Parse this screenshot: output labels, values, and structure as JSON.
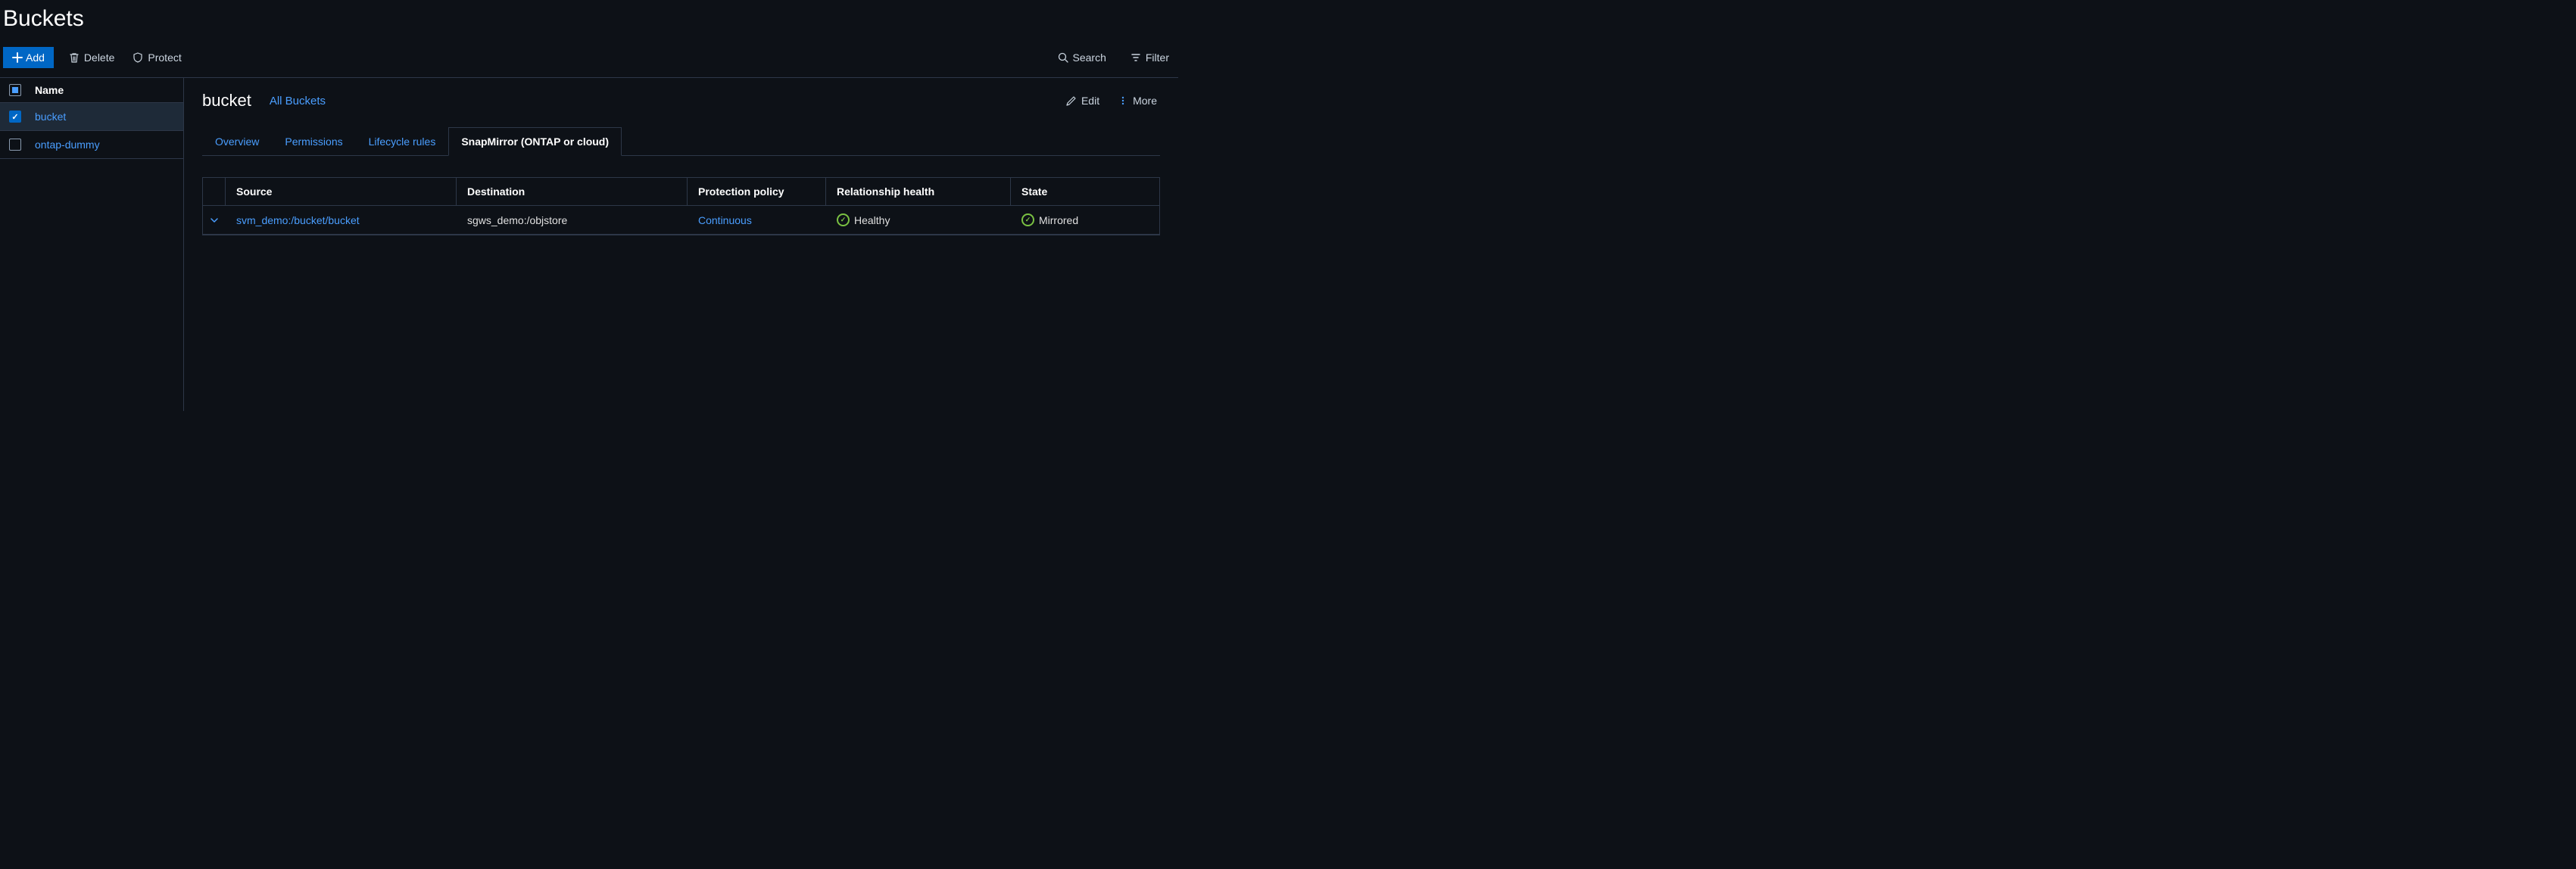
{
  "page": {
    "title": "Buckets"
  },
  "toolbar": {
    "add_label": "Add",
    "delete_label": "Delete",
    "protect_label": "Protect",
    "search_label": "Search",
    "filter_label": "Filter"
  },
  "sidebar": {
    "header": "Name",
    "items": [
      {
        "label": "bucket",
        "selected": true
      },
      {
        "label": "ontap-dummy",
        "selected": false
      }
    ]
  },
  "detail": {
    "title": "bucket",
    "breadcrumb": "All Buckets",
    "edit_label": "Edit",
    "more_label": "More",
    "tabs": [
      {
        "label": "Overview",
        "active": false
      },
      {
        "label": "Permissions",
        "active": false
      },
      {
        "label": "Lifecycle rules",
        "active": false
      },
      {
        "label": "SnapMirror (ONTAP or cloud)",
        "active": true
      }
    ]
  },
  "table": {
    "columns": {
      "source": "Source",
      "destination": "Destination",
      "policy": "Protection policy",
      "health": "Relationship health",
      "state": "State"
    },
    "rows": [
      {
        "source": "svm_demo:/bucket/bucket",
        "destination": "sgws_demo:/objstore",
        "policy": "Continuous",
        "health": "Healthy",
        "state": "Mirrored"
      }
    ]
  }
}
